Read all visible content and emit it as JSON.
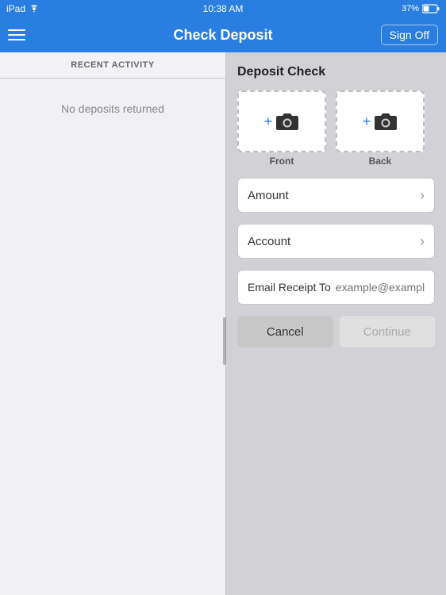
{
  "statusBar": {
    "carrier": "iPad",
    "wifi": true,
    "time": "10:38 AM",
    "battery": "37%"
  },
  "navBar": {
    "title": "Check Deposit",
    "menuIcon": "menu-icon",
    "signOffLabel": "Sign Off"
  },
  "leftPanel": {
    "recentActivityLabel": "RECENT ACTIVITY",
    "noDepositsText": "No deposits returned"
  },
  "rightPanel": {
    "depositCheckTitle": "Deposit Check",
    "frontLabel": "Front",
    "backLabel": "Back",
    "amountLabel": "Amount",
    "accountLabel": "Account",
    "emailReceiptLabel": "Email Receipt To",
    "emailPlaceholder": "example@example.com",
    "cancelLabel": "Cancel",
    "continueLabel": "Continue"
  }
}
